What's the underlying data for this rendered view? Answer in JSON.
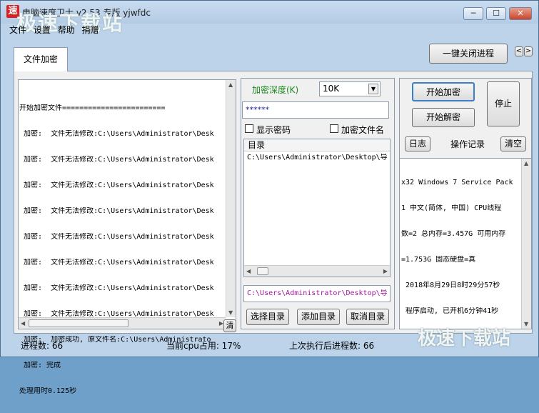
{
  "window": {
    "app_icon": "速",
    "title": "电脑速度卫士 v2.53  专版 yjwfdc",
    "watermark": "极速下载站",
    "controls": [
      "─",
      "☐",
      "✕"
    ]
  },
  "menu": [
    "文件",
    "设置",
    "帮助",
    "捐赠"
  ],
  "tab": "文件加密",
  "top_button": "一键关闭进程",
  "nav_arrows": [
    "<",
    ">"
  ],
  "log": {
    "lines": [
      "开始加密文件========================",
      " 加密:  文件无法修改:C:\\Users\\Administrator\\Desk",
      " 加密:  文件无法修改:C:\\Users\\Administrator\\Desk",
      " 加密:  文件无法修改:C:\\Users\\Administrator\\Desk",
      " 加密:  文件无法修改:C:\\Users\\Administrator\\Desk",
      " 加密:  文件无法修改:C:\\Users\\Administrator\\Desk",
      " 加密:  文件无法修改:C:\\Users\\Administrator\\Desk",
      " 加密:  文件无法修改:C:\\Users\\Administrator\\Desk",
      " 加密:  文件无法修改:C:\\Users\\Administrator\\Desk",
      " 加密:  加密成功, 原文件名:C:\\Users\\Administrato",
      " 加密: 完成",
      "处理用时0.125秒"
    ],
    "clear_label": "清"
  },
  "encrypt": {
    "depth_label": "加密深度(K)",
    "depth_value": "10K",
    "password": "******",
    "show_password_label": "显示密码",
    "encrypt_filename_label": "加密文件名",
    "dir_header": "目录",
    "dir_items": [
      "C:\\Users\\Administrator\\Desktop\\导"
    ],
    "path_value": "C:\\Users\\Administrator\\Desktop\\导",
    "select_dir": "选择目录",
    "add_dir": "添加目录",
    "cancel_dir": "取消目录"
  },
  "actions": {
    "start_encrypt": "开始加密",
    "start_decrypt": "开始解密",
    "stop": "停止",
    "log_btn": "日志",
    "op_record": "操作记录",
    "clear_btn": "清空"
  },
  "sysinfo": [
    "x32 Windows 7 Service Pack",
    "1 中文(简体, 中国) CPU线程",
    "数=2 总内存=3.457G 可用内存",
    "=1.753G 固态硬盘=真",
    " 2018年8月29日8时29分57秒",
    " 程序启动, 已开机6分钟41秒"
  ],
  "status": {
    "processes": "进程数:  66",
    "cpu": "当前cpu占用:  17%",
    "last_processes": "上次执行后进程数:  66"
  },
  "colors": {
    "frame": "#bcd3ea",
    "depth_label": "#1a8a1a",
    "path_text": "#a0169e",
    "password_text": "#1a1aa0"
  }
}
